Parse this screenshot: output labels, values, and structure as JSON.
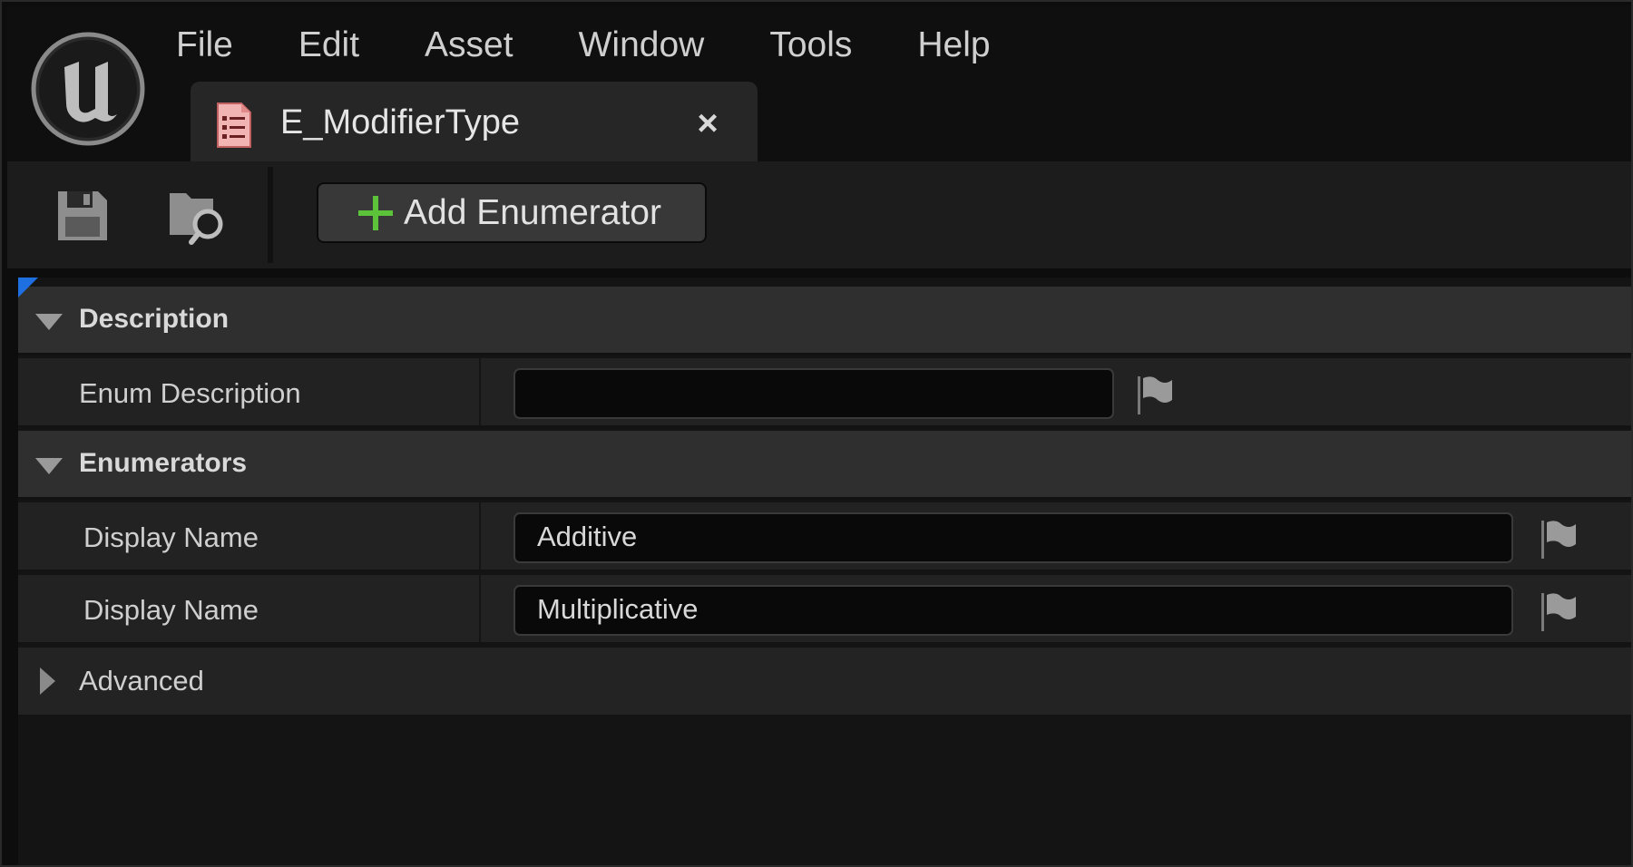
{
  "menu": [
    "File",
    "Edit",
    "Asset",
    "Window",
    "Tools",
    "Help"
  ],
  "tab": {
    "title": "E_ModifierType",
    "close_glyph": "×",
    "icon": "enum-document-icon"
  },
  "toolbar": {
    "save_icon": "save-icon",
    "browse_icon": "browse-folder-icon",
    "add_enumerator_label": "Add Enumerator"
  },
  "details": {
    "description_category": "Description",
    "enum_description_label": "Enum Description",
    "enum_description_value": "",
    "enumerators_category": "Enumerators",
    "enumerators": [
      {
        "label": "Display Name",
        "value": "Additive"
      },
      {
        "label": "Display Name",
        "value": "Multiplicative"
      }
    ],
    "advanced_category": "Advanced"
  },
  "colors": {
    "accent_blue": "#1e6fe0",
    "plus_green": "#5cc23a",
    "enum_icon_pink": "#f0a0a0"
  }
}
